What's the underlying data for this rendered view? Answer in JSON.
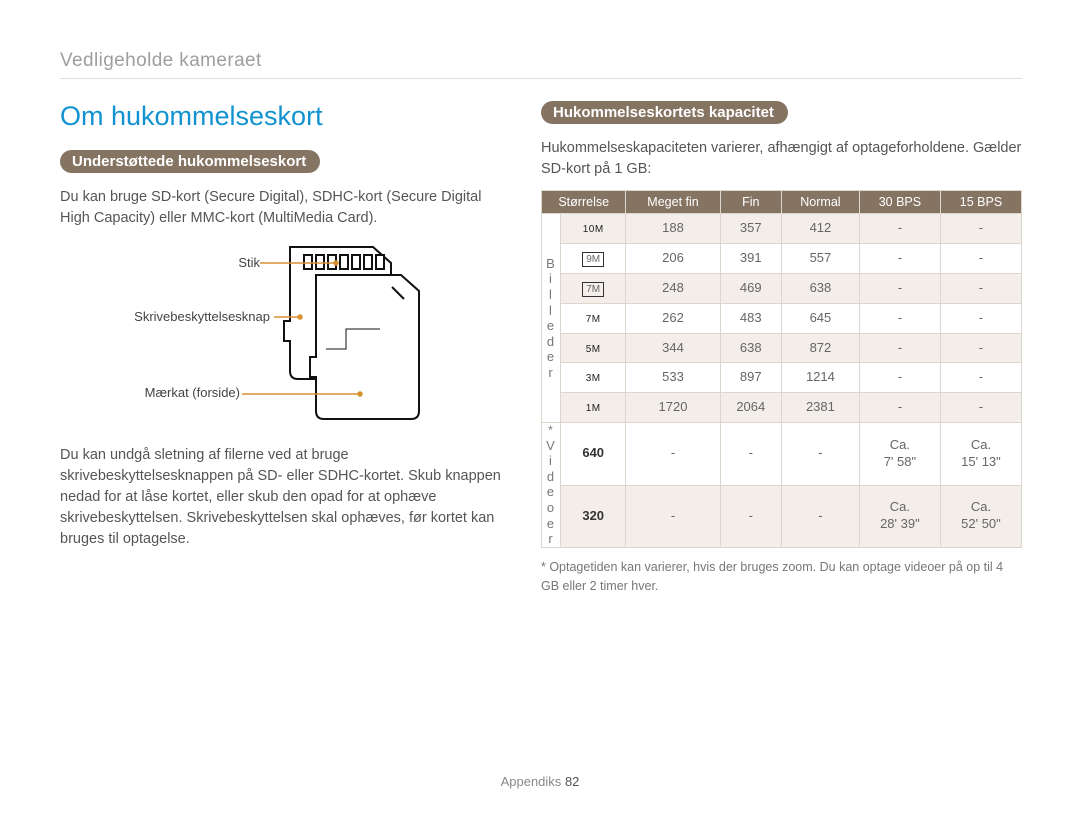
{
  "breadcrumb": "Vedligeholde kameraet",
  "heading": "Om hukommelseskort",
  "supportedPill": "Understøttede hukommelseskort",
  "supportedText": "Du kan bruge SD-kort (Secure Digital), SDHC-kort (Secure Digital High Capacity) eller MMC-kort (MultiMedia Card).",
  "diagram": {
    "stik": "Stik",
    "write": "Skrivebeskyttelsesknap",
    "label": "Mærkat (forside)"
  },
  "writeProtectText": "Du kan undgå sletning af filerne ved at bruge skrivebeskyttelsesknappen på SD- eller SDHC-kortet. Skub knappen nedad for at låse kortet, eller skub den opad for at ophæve skrivebeskyttelsen. Skrivebeskyttelsen skal ophæves, før kortet kan bruges til optagelse.",
  "capacityPill": "Hukommelseskortets kapacitet",
  "capacityText": "Hukommelseskapaciteten varierer, afhængigt af optageforholdene. Gælder SD-kort på 1 GB:",
  "tableHeaders": [
    "Størrelse",
    "Meget fin",
    "Fin",
    "Normal",
    "30 BPS",
    "15 BPS"
  ],
  "sideLabelPhotos": "Billeder",
  "sideLabelVideos": "Videoer",
  "sideLabelVideosAstk": "*",
  "photoRows": [
    {
      "size": "10M",
      "boxed": false,
      "v": [
        "188",
        "357",
        "412",
        "-",
        "-"
      ]
    },
    {
      "size": "9M",
      "boxed": true,
      "v": [
        "206",
        "391",
        "557",
        "-",
        "-"
      ]
    },
    {
      "size": "7M",
      "boxed": true,
      "v": [
        "248",
        "469",
        "638",
        "-",
        "-"
      ]
    },
    {
      "size": "7M",
      "boxed": false,
      "v": [
        "262",
        "483",
        "645",
        "-",
        "-"
      ]
    },
    {
      "size": "5M",
      "boxed": false,
      "v": [
        "344",
        "638",
        "872",
        "-",
        "-"
      ]
    },
    {
      "size": "3M",
      "boxed": false,
      "v": [
        "533",
        "897",
        "1214",
        "-",
        "-"
      ]
    },
    {
      "size": "1M",
      "boxed": false,
      "v": [
        "1720",
        "2064",
        "2381",
        "-",
        "-"
      ]
    }
  ],
  "videoRows": [
    {
      "size": "640",
      "v": [
        "-",
        "-",
        "-",
        "Ca.\n7' 58\"",
        "Ca.\n15' 13\""
      ]
    },
    {
      "size": "320",
      "v": [
        "-",
        "-",
        "-",
        "Ca.\n28' 39\"",
        "Ca.\n52' 50\""
      ]
    }
  ],
  "footnote": "* Optagetiden kan varierer, hvis der bruges zoom. Du kan optage videoer på op til 4 GB eller 2 timer hver.",
  "footerLabel": "Appendiks",
  "footerPage": "82",
  "chart_data": {
    "type": "table",
    "title": "Hukommelseskortets kapacitet (SD-kort 1 GB)",
    "groups": [
      {
        "name": "Billeder",
        "columns": [
          "Størrelse",
          "Meget fin",
          "Fin",
          "Normal",
          "30 BPS",
          "15 BPS"
        ],
        "rows": [
          [
            "10M",
            188,
            357,
            412,
            null,
            null
          ],
          [
            "9M (wide)",
            206,
            391,
            557,
            null,
            null
          ],
          [
            "7M (wide)",
            248,
            469,
            638,
            null,
            null
          ],
          [
            "7M",
            262,
            483,
            645,
            null,
            null
          ],
          [
            "5M",
            344,
            638,
            872,
            null,
            null
          ],
          [
            "3M",
            533,
            897,
            1214,
            null,
            null
          ],
          [
            "1M",
            1720,
            2064,
            2381,
            null,
            null
          ]
        ]
      },
      {
        "name": "Videoer",
        "columns": [
          "Størrelse",
          "Meget fin",
          "Fin",
          "Normal",
          "30 BPS",
          "15 BPS"
        ],
        "rows": [
          [
            "640",
            null,
            null,
            null,
            "Ca. 7' 58\"",
            "Ca. 15' 13\""
          ],
          [
            "320",
            null,
            null,
            null,
            "Ca. 28' 39\"",
            "Ca. 52' 50\""
          ]
        ]
      }
    ]
  }
}
